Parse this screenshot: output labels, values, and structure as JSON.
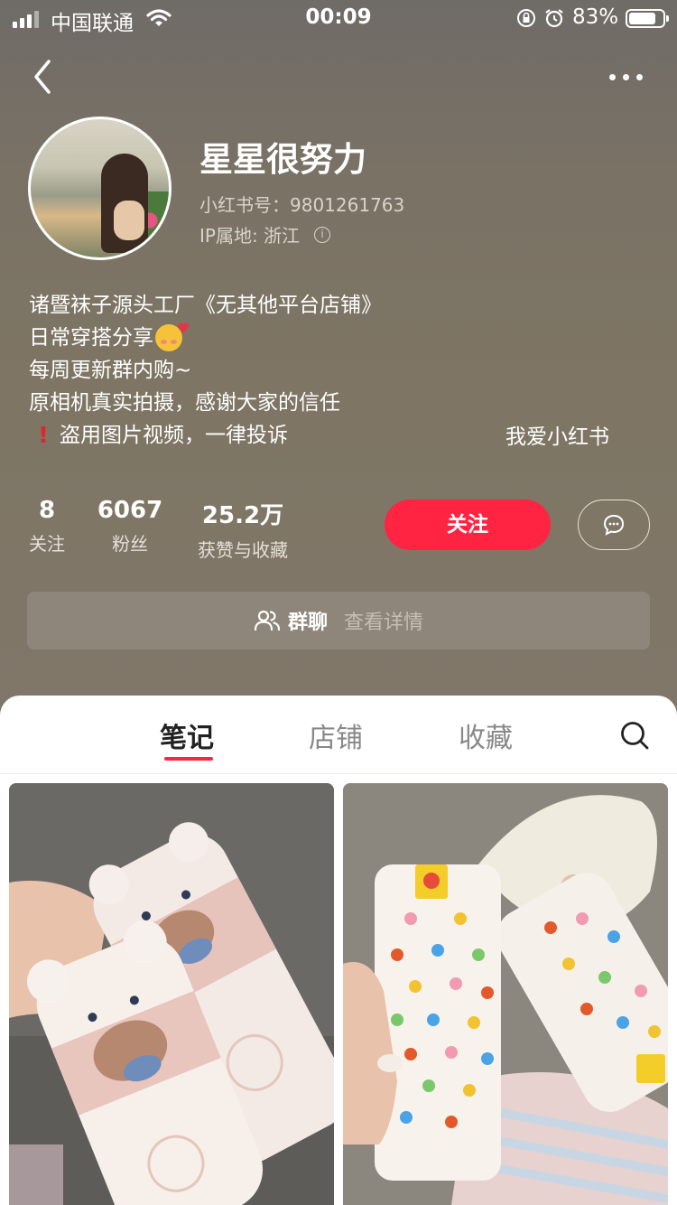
{
  "status_bar": {
    "carrier": "中国联通",
    "time": "00:09",
    "battery": "83%"
  },
  "profile": {
    "name": "星星很努力",
    "red_id": "小红书号：9801261763",
    "ip_location": "IP属地: 浙江",
    "bio": [
      "诸暨袜子源头工厂《无其他平台店铺》",
      "日常穿搭分享",
      "每周更新群内购~",
      "原相机真实拍摄，感谢大家的信任",
      "盗用图片视频，一律投诉"
    ],
    "bio_tag": "我爱小红书"
  },
  "stats": [
    {
      "num": "8",
      "label": "关注"
    },
    {
      "num": "6067",
      "label": "粉丝"
    },
    {
      "num": "25.2万",
      "label": "获赞与收藏"
    }
  ],
  "actions": {
    "follow": "关注"
  },
  "group": {
    "title": "群聊",
    "detail": "查看详情"
  },
  "tabs": [
    {
      "label": "笔记",
      "active": true
    },
    {
      "label": "店铺",
      "active": false
    },
    {
      "label": "收藏",
      "active": false
    }
  ],
  "colors": {
    "accent": "#ff2442",
    "hero_bg": "#7e7564"
  },
  "icons": {
    "back": "chevron-left-icon",
    "more": "more-icon",
    "info": "info-icon",
    "message": "chat-icon",
    "group": "group-icon",
    "search": "search-icon"
  }
}
